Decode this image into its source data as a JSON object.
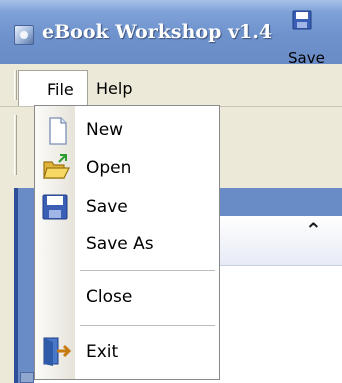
{
  "window": {
    "title": "eBook Workshop v1.4"
  },
  "menubar": {
    "file_label": "File",
    "help_label": "Help"
  },
  "toolbar": {
    "save_label": "Save"
  },
  "file_menu": {
    "items": [
      {
        "label": "New",
        "icon": "new-document-icon"
      },
      {
        "label": "Open",
        "icon": "open-folder-icon"
      },
      {
        "label": "Save",
        "icon": "floppy-disk-icon"
      },
      {
        "label": "Save As",
        "icon": ""
      },
      {
        "label": "Close",
        "icon": ""
      },
      {
        "label": "Exit",
        "icon": "exit-door-icon"
      }
    ]
  },
  "colors": {
    "titlebar": "#6e92cc",
    "menu_background": "#ffffff",
    "window_face": "#ece9d8",
    "workspace": "#6a8cc6"
  }
}
